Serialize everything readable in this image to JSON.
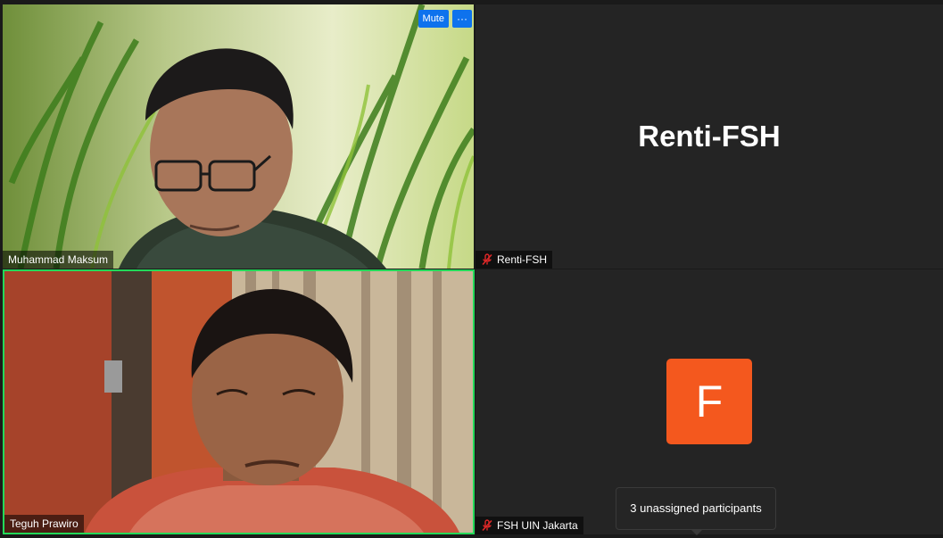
{
  "participants": [
    {
      "name": "Muhammad Maksum",
      "video_on": true,
      "muted": false
    },
    {
      "name": "Renti-FSH",
      "video_on": false,
      "muted": true,
      "display_title": "Renti-FSH"
    },
    {
      "name": "Teguh Prawiro",
      "video_on": true,
      "muted": false,
      "active_speaker": true
    },
    {
      "name": "FSH UIN Jakarta",
      "video_on": false,
      "muted": true,
      "avatar_letter": "F",
      "avatar_color": "#f4581e"
    }
  ],
  "controls": {
    "mute_label": "Mute",
    "more_label": "···"
  },
  "tooltip": {
    "text": "3 unassigned participants"
  },
  "colors": {
    "active_speaker_border": "#23d959",
    "button_blue": "#0e72ed",
    "muted_icon": "#e02828"
  }
}
